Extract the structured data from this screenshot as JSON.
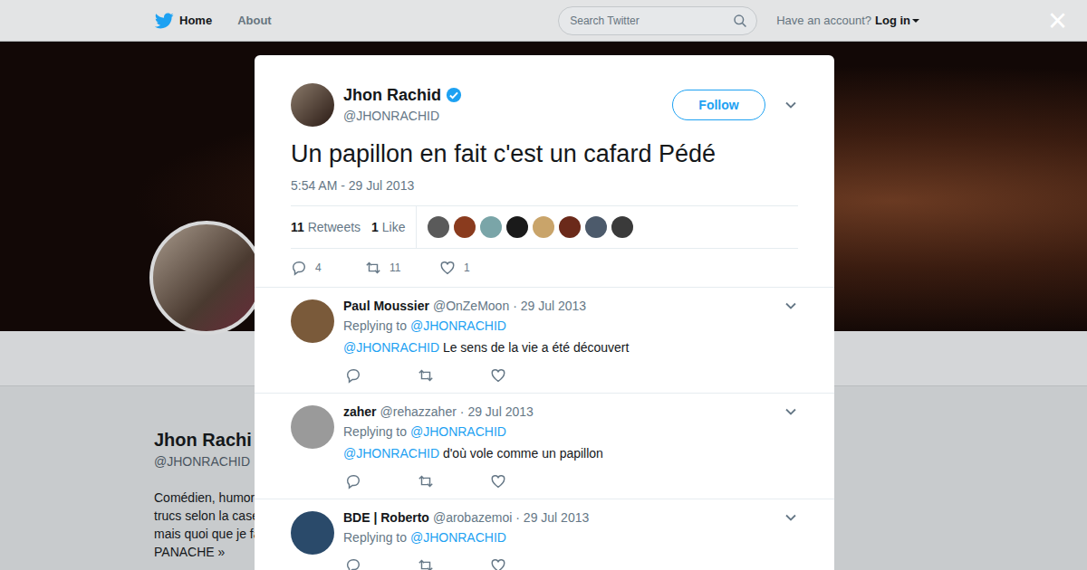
{
  "nav": {
    "items": [
      "Home",
      "About"
    ],
    "search_placeholder": "Search Twitter",
    "account_prompt": "Have an account?",
    "login": "Log in",
    "close": "×"
  },
  "profile": {
    "name": "Jhon Rachi",
    "handle": "@JHONRACHID",
    "bio": [
      "Comédien, humor",
      "trucs selon la case",
      "mais quoi que je fa",
      "PANACHE »"
    ]
  },
  "tweet": {
    "name": "Jhon Rachid",
    "handle": "@JHONRACHID",
    "verified": true,
    "follow": "Follow",
    "text": "Un papillon en fait c'est un cafard Pédé",
    "time": "5:54 AM - 29 Jul 2013",
    "retweets": "11",
    "retweets_label": "Retweets",
    "likes": "1",
    "likes_label": "Like",
    "liker_avatar_count": 8
  },
  "actions": {
    "replies": "4",
    "retweets": "11",
    "likes": "1"
  },
  "replies": [
    {
      "name": "Paul Moussier",
      "handle": "@OnZeMoon",
      "date": "· 29 Jul 2013",
      "replying_label": "Replying to",
      "replying_to": "@JHONRACHID",
      "mention": "@JHONRACHID",
      "text": "Le sens de la vie a été découvert"
    },
    {
      "name": "zaher",
      "handle": "@rehazzaher",
      "date": "· 29 Jul 2013",
      "replying_label": "Replying to",
      "replying_to": "@JHONRACHID",
      "mention": "@JHONRACHID",
      "text": "d'où vole comme un papillon"
    },
    {
      "name": "BDE | Roberto",
      "handle": "@arobazemoi",
      "date": "· 29 Jul 2013",
      "replying_label": "Replying to",
      "replying_to": "@JHONRACHID",
      "mention": "",
      "text": ""
    }
  ]
}
